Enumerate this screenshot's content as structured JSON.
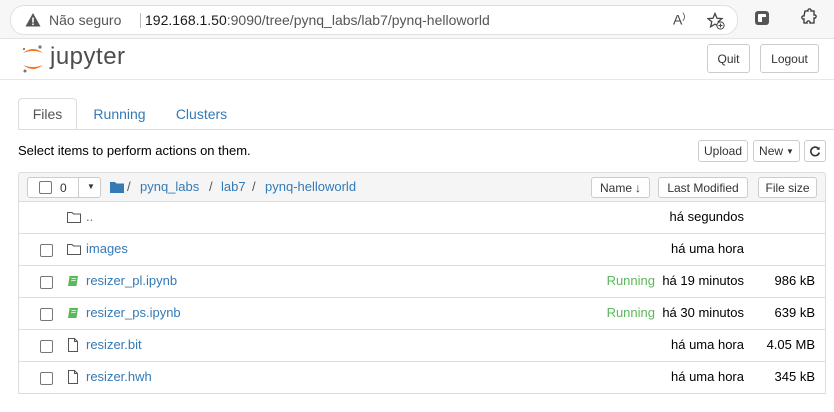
{
  "browser": {
    "security_label": "Não seguro",
    "url_host": "192.168.1.50",
    "url_rest": ":9090/tree/pynq_labs/lab7/pynq-helloworld"
  },
  "header": {
    "logo_text": "jupyter",
    "quit_label": "Quit",
    "logout_label": "Logout"
  },
  "tabs": [
    {
      "label": "Files"
    },
    {
      "label": "Running"
    },
    {
      "label": "Clusters"
    }
  ],
  "hint": "Select items to perform actions on them.",
  "toolbar": {
    "upload_label": "Upload",
    "new_label": "New",
    "selected_count": "0"
  },
  "breadcrumb": [
    "pynq_labs",
    "lab7",
    "pynq-helloworld"
  ],
  "columns": {
    "name": "Name",
    "last_modified": "Last Modified",
    "file_size": "File size"
  },
  "files": [
    {
      "name": "..",
      "type": "folder",
      "status": "",
      "modified": "há segundos",
      "size": ""
    },
    {
      "name": "images",
      "type": "folder",
      "status": "",
      "modified": "há uma hora",
      "size": ""
    },
    {
      "name": "resizer_pl.ipynb",
      "type": "notebook",
      "status": "Running",
      "modified": "há 19 minutos",
      "size": "986 kB"
    },
    {
      "name": "resizer_ps.ipynb",
      "type": "notebook",
      "status": "Running",
      "modified": "há 30 minutos",
      "size": "639 kB"
    },
    {
      "name": "resizer.bit",
      "type": "file",
      "status": "",
      "modified": "há uma hora",
      "size": "4.05 MB"
    },
    {
      "name": "resizer.hwh",
      "type": "file",
      "status": "",
      "modified": "há uma hora",
      "size": "345 kB"
    }
  ],
  "colors": {
    "link": "#337ab7",
    "running": "#5cb85c",
    "logo_orange": "#f37726"
  }
}
